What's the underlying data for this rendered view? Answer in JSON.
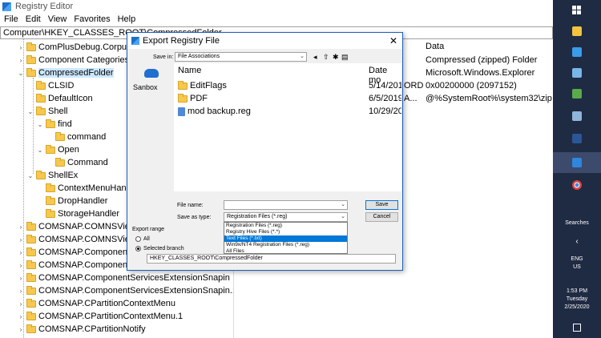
{
  "registry": {
    "title": "Registry Editor",
    "menu": [
      "File",
      "Edit",
      "View",
      "Favorites",
      "Help"
    ],
    "address": "Computer\\HKEY_CLASSES_ROOT\\CompressedFolder",
    "tree": [
      {
        "label": "ComPlusDebug.Corpub"
      },
      {
        "label": "Component Categories"
      },
      {
        "label": "CompressedFolder"
      },
      {
        "label": "CLSID"
      },
      {
        "label": "DefaultIcon"
      },
      {
        "label": "Shell"
      },
      {
        "label": "find"
      },
      {
        "label": "command"
      },
      {
        "label": "Open"
      },
      {
        "label": "Command"
      },
      {
        "label": "ShellEx"
      },
      {
        "label": "ContextMenuHandl"
      },
      {
        "label": "DropHandler"
      },
      {
        "label": "StorageHandler"
      },
      {
        "label": "COMSNAP.COMNSView"
      },
      {
        "label": "COMSNAP.COMNSView"
      },
      {
        "label": "COMSNAP.ComponentD"
      },
      {
        "label": "COMSNAP.ComponentD"
      },
      {
        "label": "COMSNAP.ComponentServicesExtensionSnapin"
      },
      {
        "label": "COMSNAP.ComponentServicesExtensionSnapin.1"
      },
      {
        "label": "COMSNAP.CPartitionContextMenu"
      },
      {
        "label": "COMSNAP.CPartitionContextMenu.1"
      },
      {
        "label": "COMSNAP.CPartitionNotify"
      }
    ],
    "detail": {
      "header": "Data",
      "rows": [
        {
          "prefix": "",
          "data": "Compressed (zipped) Folder"
        },
        {
          "prefix": "",
          "data": "Microsoft.Windows.Explorer"
        },
        {
          "prefix": "ORD",
          "data": "0x00200000 (2097152)"
        },
        {
          "prefix": "A...",
          "data": "@%SystemRoot%\\system32\\zip"
        }
      ]
    }
  },
  "dialog": {
    "title": "Export Registry File",
    "close": "✕",
    "save_in_label": "Save in:",
    "save_in_value": "File Associations",
    "places_label": "Sanbox",
    "list_header_name": "Name",
    "list_header_date": "Date mo",
    "files": [
      {
        "name": "EditFlags",
        "date": "5/14/201"
      },
      {
        "name": "PDF",
        "date": "6/5/2019"
      },
      {
        "name": "mod backup.reg",
        "date": "10/29/20"
      }
    ],
    "file_name_label": "File name:",
    "file_name_value": "",
    "save_as_type_label": "Save as type:",
    "save_as_type_value": "Registration Files (*.reg)",
    "save_button": "Save",
    "cancel_button": "Cancel",
    "type_options": [
      "Registration Files (*.reg)",
      "Registry Hive Files (*.*)",
      "Text Files (*.txt)",
      "Win9x/NT4 Registration Files (*.reg)",
      "All Files"
    ],
    "export_range_label": "Export range",
    "all_label": "All",
    "selected_branch_label": "Selected branch",
    "branch_value": "HKEY_CLASSES_ROOT\\CompressedFolder"
  },
  "taskbar": {
    "searches_label": "Searches",
    "lang": "ENG",
    "region": "US",
    "time": "1:53 PM",
    "day": "Tuesday",
    "date": "2/25/2020"
  }
}
